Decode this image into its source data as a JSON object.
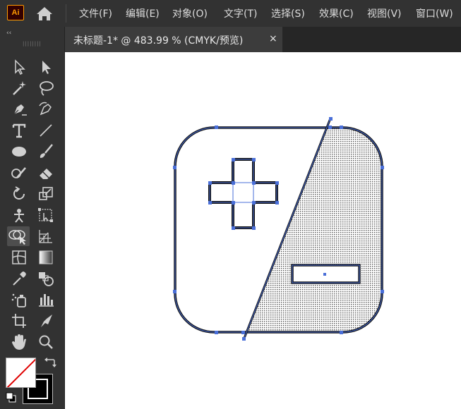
{
  "app": {
    "logo_text": "Ai",
    "accent": "#ff9a00"
  },
  "menu": {
    "items": [
      "文件(F)",
      "编辑(E)",
      "对象(O)",
      "文字(T)",
      "选择(S)",
      "效果(C)",
      "视图(V)",
      "窗口(W)"
    ]
  },
  "document_tab": {
    "title": "未标题-1* @ 483.99 % (CMYK/预览)",
    "close": "×"
  },
  "toolbar": {
    "collapse": "‹‹",
    "grip": "||||||||",
    "tools": [
      [
        "selection-tool",
        "direct-selection-tool"
      ],
      [
        "magic-wand-tool",
        "lasso-tool"
      ],
      [
        "pen-tool",
        "curvature-tool"
      ],
      [
        "type-tool",
        "line-segment-tool"
      ],
      [
        "ellipse-tool",
        "paintbrush-tool"
      ],
      [
        "shaper-tool",
        "eraser-tool"
      ],
      [
        "rotate-tool",
        "scale-tool"
      ],
      [
        "puppet-warp-tool",
        "free-transform-tool"
      ],
      [
        "shape-builder-tool",
        "perspective-grid-tool"
      ],
      [
        "mesh-tool",
        "gradient-tool"
      ],
      [
        "eyedropper-tool",
        "blend-tool"
      ],
      [
        "symbol-sprayer-tool",
        "column-graph-tool"
      ],
      [
        "artboard-tool",
        "slice-tool"
      ],
      [
        "hand-tool",
        "zoom-tool"
      ]
    ],
    "active_tool": "shape-builder-tool",
    "fill_color": "none",
    "stroke_color": "#000000"
  },
  "colors": {
    "selection": "#4a6fd8",
    "shape_stroke": "#111111"
  }
}
